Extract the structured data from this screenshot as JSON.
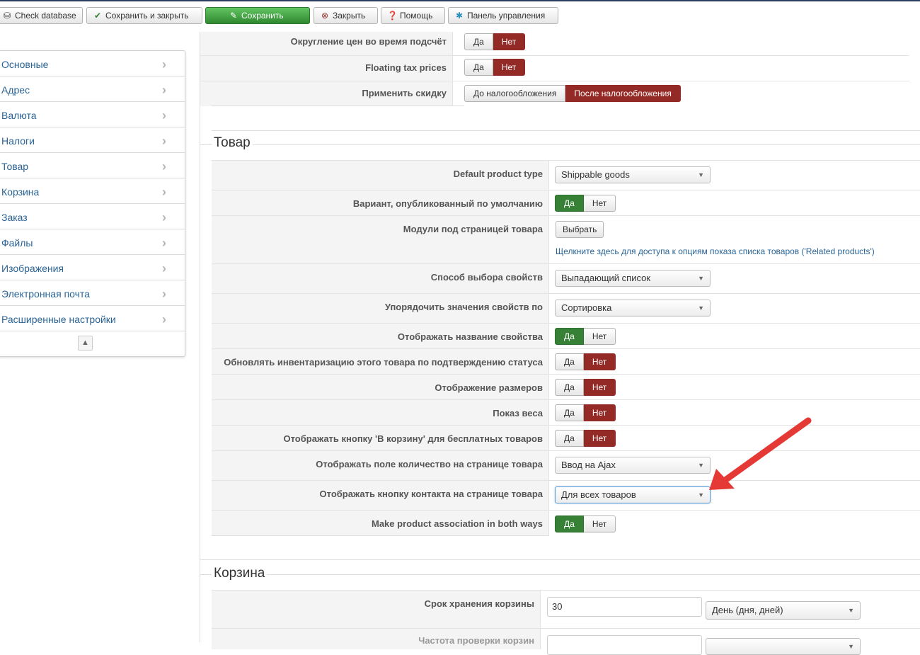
{
  "toolbar": {
    "check_db": "Check database",
    "save_close": "Сохранить и закрыть",
    "save": "Сохранить",
    "close": "Закрыть",
    "help": "Помощь",
    "control_panel": "Панель управления"
  },
  "sidebar": {
    "items": [
      {
        "label": "Основные"
      },
      {
        "label": "Адрес"
      },
      {
        "label": "Валюта"
      },
      {
        "label": "Налоги"
      },
      {
        "label": "Товар"
      },
      {
        "label": "Корзина"
      },
      {
        "label": "Заказ"
      },
      {
        "label": "Файлы"
      },
      {
        "label": "Изображения"
      },
      {
        "label": "Электронная почта"
      },
      {
        "label": "Расширенные настройки"
      }
    ]
  },
  "taxes": {
    "rounding": {
      "label": "Округление цен во время подсчёт",
      "yes": "Да",
      "no": "Нет"
    },
    "floating": {
      "label": "Floating tax prices",
      "yes": "Да",
      "no": "Нет"
    },
    "discount": {
      "label": "Применить скидку",
      "before": "До налогообложения",
      "after": "После налогообложения"
    }
  },
  "product": {
    "legend": "Товар",
    "default_type": {
      "label": "Default product type",
      "value": "Shippable goods"
    },
    "published_variant": {
      "label": "Вариант, опубликованный по умолчанию",
      "yes": "Да",
      "no": "Нет"
    },
    "modules": {
      "label": "Модули под страницей товара",
      "button": "Выбрать",
      "link": "Щелкните здесь для доступа к опциям показа списка товаров ('Related products')"
    },
    "char_select": {
      "label": "Способ выбора свойств",
      "value": "Выпадающий список"
    },
    "char_order": {
      "label": "Упорядочить значения свойств по",
      "value": "Сортировка"
    },
    "show_char_name": {
      "label": "Отображать название свойства",
      "yes": "Да",
      "no": "Нет"
    },
    "update_inventory": {
      "label": "Обновлять инвентаризацию этого товара по подтверждению статуса",
      "yes": "Да",
      "no": "Нет"
    },
    "dimensions": {
      "label": "Отображение размеров",
      "yes": "Да",
      "no": "Нет"
    },
    "weight": {
      "label": "Показ веса",
      "yes": "Да",
      "no": "Нет"
    },
    "free_cart_btn": {
      "label": "Отображать кнопку 'В корзину' для бесплатных товаров",
      "yes": "Да",
      "no": "Нет"
    },
    "quantity_field": {
      "label": "Отображать поле количество на странице товара",
      "value": "Ввод на Ajax"
    },
    "contact_btn": {
      "label": "Отображать кнопку контакта на странице товара",
      "value": "Для всех товаров"
    },
    "association": {
      "label": "Make product association in both ways",
      "yes": "Да",
      "no": "Нет"
    }
  },
  "cart": {
    "legend": "Корзина",
    "retention": {
      "label": "Срок хранения корзины",
      "value": "30",
      "unit": "День (дня, дней)"
    },
    "check_freq": {
      "label": "Частота проверки корзин"
    }
  },
  "colors": {
    "red": "#942a25",
    "green": "#378137",
    "link": "#2a6496",
    "annotation_arrow": "#e53935"
  }
}
